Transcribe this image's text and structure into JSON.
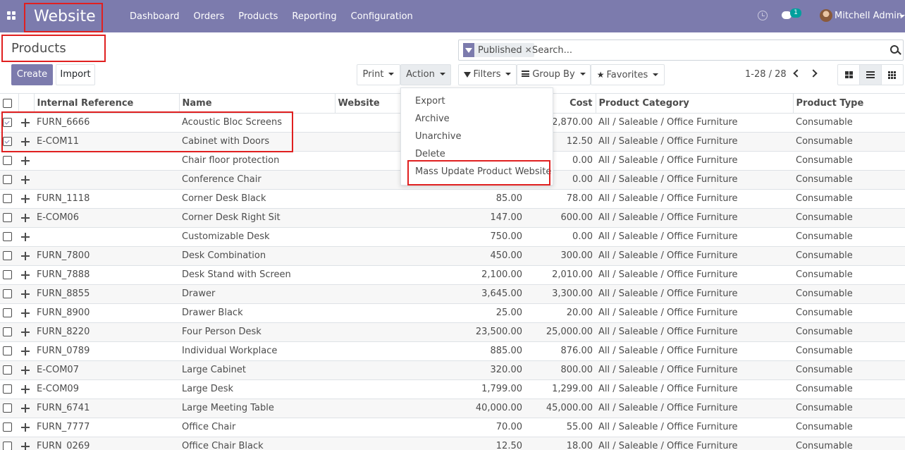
{
  "navbar": {
    "app_title": "Website",
    "menu": [
      "Dashboard",
      "Orders",
      "Products",
      "Reporting",
      "Configuration"
    ],
    "chat_badge": "1",
    "user": "Mitchell Admin"
  },
  "control_panel": {
    "title": "Products",
    "create_label": "Create",
    "import_label": "Import",
    "print_label": "Print",
    "action_label": "Action",
    "filters_label": "Filters",
    "groupby_label": "Group By",
    "favorites_label": "Favorites",
    "search_facet": "Published",
    "search_placeholder": "Search...",
    "pager": "1-28 / 28"
  },
  "action_menu": {
    "items": [
      "Export",
      "Archive",
      "Unarchive",
      "Delete",
      "Mass Update Product Website"
    ]
  },
  "table": {
    "columns": [
      "Internal Reference",
      "Name",
      "Website",
      "Cost",
      "Product Category",
      "Product Type"
    ],
    "rows": [
      {
        "checked": true,
        "ref": "FURN_6666",
        "name": "Acoustic Bloc Screens",
        "price": "",
        "cost": "2,870.00",
        "category": "All / Saleable / Office Furniture",
        "type": "Consumable"
      },
      {
        "checked": true,
        "ref": "E-COM11",
        "name": "Cabinet with Doors",
        "price": "",
        "cost": "12.50",
        "category": "All / Saleable / Office Furniture",
        "type": "Consumable"
      },
      {
        "checked": false,
        "ref": "",
        "name": "Chair floor protection",
        "price": "",
        "cost": "0.00",
        "category": "All / Saleable / Office Furniture",
        "type": "Consumable"
      },
      {
        "checked": false,
        "ref": "",
        "name": "Conference Chair",
        "price": "",
        "cost": "0.00",
        "category": "All / Saleable / Office Furniture",
        "type": "Consumable"
      },
      {
        "checked": false,
        "ref": "FURN_1118",
        "name": "Corner Desk Black",
        "price": "85.00",
        "cost": "78.00",
        "category": "All / Saleable / Office Furniture",
        "type": "Consumable"
      },
      {
        "checked": false,
        "ref": "E-COM06",
        "name": "Corner Desk Right Sit",
        "price": "147.00",
        "cost": "600.00",
        "category": "All / Saleable / Office Furniture",
        "type": "Consumable"
      },
      {
        "checked": false,
        "ref": "",
        "name": "Customizable Desk",
        "price": "750.00",
        "cost": "0.00",
        "category": "All / Saleable / Office Furniture",
        "type": "Consumable"
      },
      {
        "checked": false,
        "ref": "FURN_7800",
        "name": "Desk Combination",
        "price": "450.00",
        "cost": "300.00",
        "category": "All / Saleable / Office Furniture",
        "type": "Consumable"
      },
      {
        "checked": false,
        "ref": "FURN_7888",
        "name": "Desk Stand with Screen",
        "price": "2,100.00",
        "cost": "2,010.00",
        "category": "All / Saleable / Office Furniture",
        "type": "Consumable"
      },
      {
        "checked": false,
        "ref": "FURN_8855",
        "name": "Drawer",
        "price": "3,645.00",
        "cost": "3,300.00",
        "category": "All / Saleable / Office Furniture",
        "type": "Consumable"
      },
      {
        "checked": false,
        "ref": "FURN_8900",
        "name": "Drawer Black",
        "price": "25.00",
        "cost": "20.00",
        "category": "All / Saleable / Office Furniture",
        "type": "Consumable"
      },
      {
        "checked": false,
        "ref": "FURN_8220",
        "name": "Four Person Desk",
        "price": "23,500.00",
        "cost": "25,000.00",
        "category": "All / Saleable / Office Furniture",
        "type": "Consumable"
      },
      {
        "checked": false,
        "ref": "FURN_0789",
        "name": "Individual Workplace",
        "price": "885.00",
        "cost": "876.00",
        "category": "All / Saleable / Office Furniture",
        "type": "Consumable"
      },
      {
        "checked": false,
        "ref": "E-COM07",
        "name": "Large Cabinet",
        "price": "320.00",
        "cost": "800.00",
        "category": "All / Saleable / Office Furniture",
        "type": "Consumable"
      },
      {
        "checked": false,
        "ref": "E-COM09",
        "name": "Large Desk",
        "price": "1,799.00",
        "cost": "1,299.00",
        "category": "All / Saleable / Office Furniture",
        "type": "Consumable"
      },
      {
        "checked": false,
        "ref": "FURN_6741",
        "name": "Large Meeting Table",
        "price": "40,000.00",
        "cost": "45,000.00",
        "category": "All / Saleable / Office Furniture",
        "type": "Consumable"
      },
      {
        "checked": false,
        "ref": "FURN_7777",
        "name": "Office Chair",
        "price": "70.00",
        "cost": "55.00",
        "category": "All / Saleable / Office Furniture",
        "type": "Consumable"
      },
      {
        "checked": false,
        "ref": "FURN_0269",
        "name": "Office Chair Black",
        "price": "12.50",
        "cost": "18.00",
        "category": "All / Saleable / Office Furniture",
        "type": "Consumable"
      }
    ]
  }
}
